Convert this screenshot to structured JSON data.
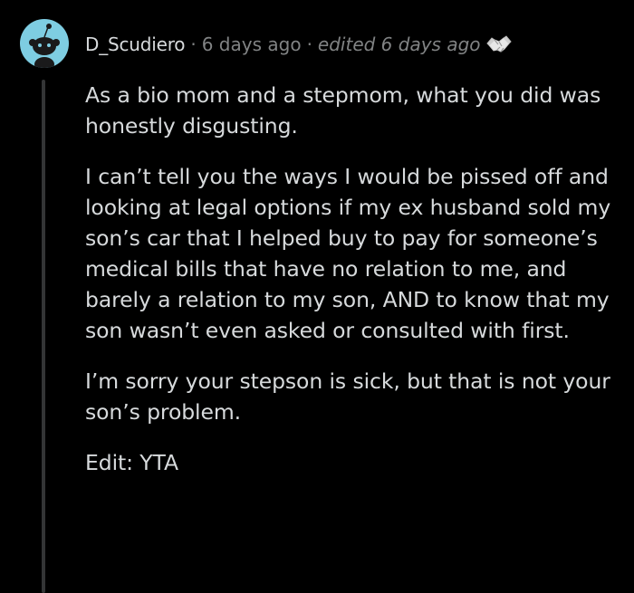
{
  "comment": {
    "username": "D_Scudiero",
    "separator": "·",
    "timestamp": "6 days ago",
    "edited": "edited 6 days ago",
    "award_icon": "handshake-award-icon",
    "avatar_icon": "snoo-avatar-icon",
    "avatar_color": "#7ecde2",
    "paragraphs": [
      "As a bio mom and a stepmom, what you did was honestly disgusting.",
      "I can’t tell you the ways I would be pissed off and looking at legal options if my ex husband sold my son’s car that I helped buy to pay for someone’s medical bills that have no relation to me, and barely a relation to my son, AND to know that my son wasn’t even asked or consulted with first.",
      "I’m sorry your stepson is sick, but that is not your son’s problem.",
      "Edit: YTA"
    ]
  }
}
